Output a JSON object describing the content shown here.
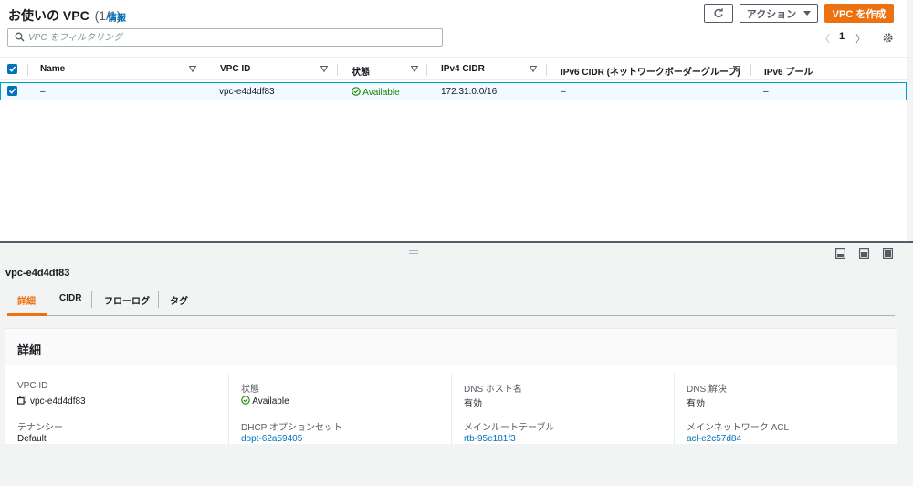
{
  "header": {
    "title": "お使いの VPC",
    "count": "(1/1)",
    "info_link": "情報",
    "action_label": "アクション",
    "create_label": "VPC を作成"
  },
  "search": {
    "placeholder": "VPC をフィルタリング"
  },
  "pagination": {
    "prev": "〈",
    "current": "1",
    "next": "〉"
  },
  "table": {
    "columns": [
      "Name",
      "VPC ID",
      "状態",
      "IPv4 CIDR",
      "IPv6 CIDR (ネットワークボーダーグループ)",
      "IPv6 プール"
    ],
    "rows": [
      {
        "name": "–",
        "vpc_id": "vpc-e4d4df83",
        "state": "Available",
        "ipv4": "172.31.0.0/16",
        "ipv6": "–",
        "ipv6_pool": "–"
      }
    ]
  },
  "details": {
    "selected_id": "vpc-e4d4df83",
    "tabs": [
      "詳細",
      "CIDR",
      "フローログ",
      "タグ"
    ],
    "card_title": "詳細",
    "fields": {
      "vpc_id_label": "VPC ID",
      "vpc_id_value": "vpc-e4d4df83",
      "state_label": "状態",
      "state_value": "Available",
      "dns_host_label": "DNS ホスト名",
      "dns_host_value": "有効",
      "dns_res_label": "DNS 解決",
      "dns_res_value": "有効",
      "tenancy_label": "テナンシー",
      "tenancy_value": "Default",
      "dhcp_label": "DHCP オプションセット",
      "dhcp_value": "dopt-62a59405",
      "main_rt_label": "メインルートテーブル",
      "main_rt_value": "rtb-95e181f3",
      "main_acl_label": "メインネットワーク ACL",
      "main_acl_value": "acl-e2c57d84"
    }
  },
  "colors": {
    "accent": "#ec7211",
    "link": "#0073bb",
    "available": "#1d8102",
    "selected_row": "#f1faff"
  },
  "icons": [
    "refresh-icon",
    "caret-down-icon",
    "search-icon",
    "gear-icon",
    "sort-icon",
    "check-circle-icon",
    "copy-icon",
    "drag-grip-icon",
    "panel-layout-icon"
  ]
}
